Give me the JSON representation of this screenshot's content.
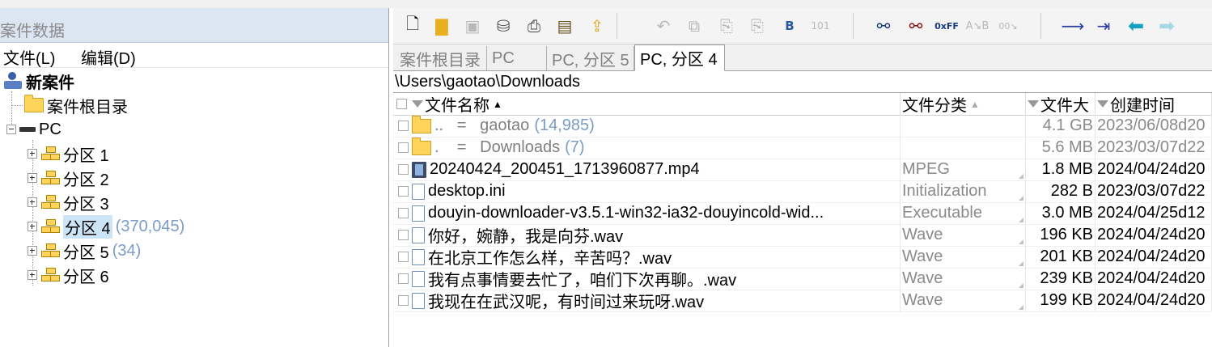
{
  "left_panel": {
    "title": "案件数据",
    "menu": [
      "文件(L)",
      "编辑(D)"
    ],
    "tree": {
      "case": "新案件",
      "root_dir": "案件根目录",
      "pc": "PC",
      "partitions": [
        {
          "label": "分区 1",
          "count": ""
        },
        {
          "label": "分区 2",
          "count": ""
        },
        {
          "label": "分区 3",
          "count": ""
        },
        {
          "label": "分区 4",
          "count": "(370,045)"
        },
        {
          "label": "分区 5",
          "count": "(34)"
        },
        {
          "label": "分区 6",
          "count": ""
        }
      ]
    }
  },
  "toolbar": {
    "icons": [
      "new-case-icon",
      "open-folder-icon",
      "save-icon",
      "disk-icon",
      "printer-icon",
      "properties-icon",
      "upload-icon",
      "undo-icon",
      "copy-icon",
      "paste-icon",
      "paste-special-icon",
      "hex-b-icon",
      "bin-icon",
      "binoculars-icon",
      "binoculars-red-icon",
      "hex-search-icon",
      "replace-icon",
      "hex-replace-icon",
      "go-to-icon",
      "go-to-mark-icon",
      "back-icon",
      "forward-icon"
    ]
  },
  "tabs": [
    "案件根目录",
    "PC",
    "PC, 分区 5",
    "PC, 分区 4"
  ],
  "path": "\\Users\\gaotao\\Downloads",
  "columns": [
    "文件名称",
    "文件分类",
    "文件大",
    "创建时间"
  ],
  "rows": [
    {
      "name": "..   =   gaotao",
      "count": "(14,985)",
      "type": "",
      "size": "4.1 GB",
      "created": "2023/06/08d20",
      "icon": "folder",
      "dim": true
    },
    {
      "name": ".    =   Downloads",
      "count": "(7)",
      "type": "",
      "size": "5.6 MB",
      "created": "2023/03/07d22",
      "icon": "folder",
      "dim": true
    },
    {
      "name": "20240424_200451_1713960877.mp4",
      "count": "",
      "type": "MPEG",
      "size": "1.8 MB",
      "created": "2024/04/24d20",
      "icon": "film",
      "dim": false
    },
    {
      "name": "desktop.ini",
      "count": "",
      "type": "Initialization",
      "size": "282 B",
      "created": "2023/03/07d22",
      "icon": "file",
      "dim": false
    },
    {
      "name": "douyin-downloader-v3.5.1-win32-ia32-douyincold-wid...",
      "count": "",
      "type": "Executable",
      "size": "3.0 MB",
      "created": "2024/04/25d12",
      "icon": "file",
      "dim": false
    },
    {
      "name": "你好，婉静，我是向芬.wav",
      "count": "",
      "type": "Wave",
      "size": "196 KB",
      "created": "2024/04/24d20",
      "icon": "file",
      "dim": false
    },
    {
      "name": "在北京工作怎么样，辛苦吗？.wav",
      "count": "",
      "type": "Wave",
      "size": "201 KB",
      "created": "2024/04/24d20",
      "icon": "file",
      "dim": false
    },
    {
      "name": "我有点事情要去忙了，咱们下次再聊。.wav",
      "count": "",
      "type": "Wave",
      "size": "239 KB",
      "created": "2024/04/24d20",
      "icon": "file",
      "dim": false
    },
    {
      "name": "我现在在武汉呢，有时间过来玩呀.wav",
      "count": "",
      "type": "Wave",
      "size": "199 KB",
      "created": "2024/04/24d20",
      "icon": "file",
      "dim": false
    }
  ]
}
